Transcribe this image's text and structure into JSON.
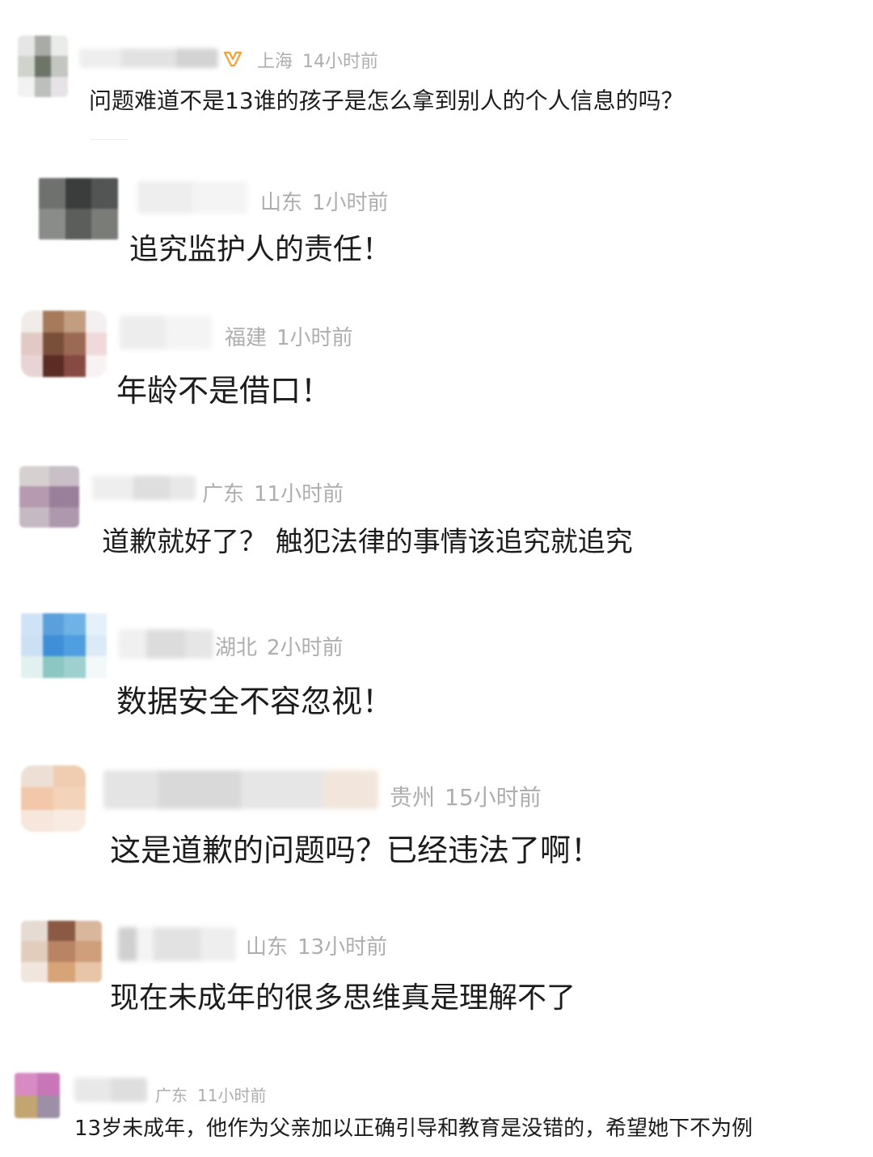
{
  "comments": [
    {
      "region": "上海",
      "time": "14小时前",
      "text": "问题难道不是13谁的孩子是怎么拿到别人的个人信息的吗？"
    },
    {
      "region": "山东",
      "time": "1小时前",
      "text": "追究监护人的责任！"
    },
    {
      "region": "福建",
      "time": "1小时前",
      "text": "年龄不是借口！"
    },
    {
      "region": "广东",
      "time": "11小时前",
      "text": "道歉就好了？ 触犯法律的事情该追究就追究"
    },
    {
      "region": "湖北",
      "time": "2小时前",
      "text": "数据安全不容忽视！"
    },
    {
      "region": "贵州",
      "time": "15小时前",
      "text": "这是道歉的问题吗？已经违法了啊！"
    },
    {
      "region": "山东",
      "time": "13小时前",
      "text": "现在未成年的很多思维真是理解不了"
    },
    {
      "region": "广东",
      "time": "11小时前",
      "text": "13岁未成年，他作为父亲加以正确引导和教育是没错的，希望她下不为例"
    }
  ],
  "icons": {
    "vip_badge": "orange-vip-badge-icon"
  },
  "colors": {
    "meta_text": "#aeaeae",
    "comment_text": "#1c1c1c",
    "vip_badge": "#f0a640"
  }
}
